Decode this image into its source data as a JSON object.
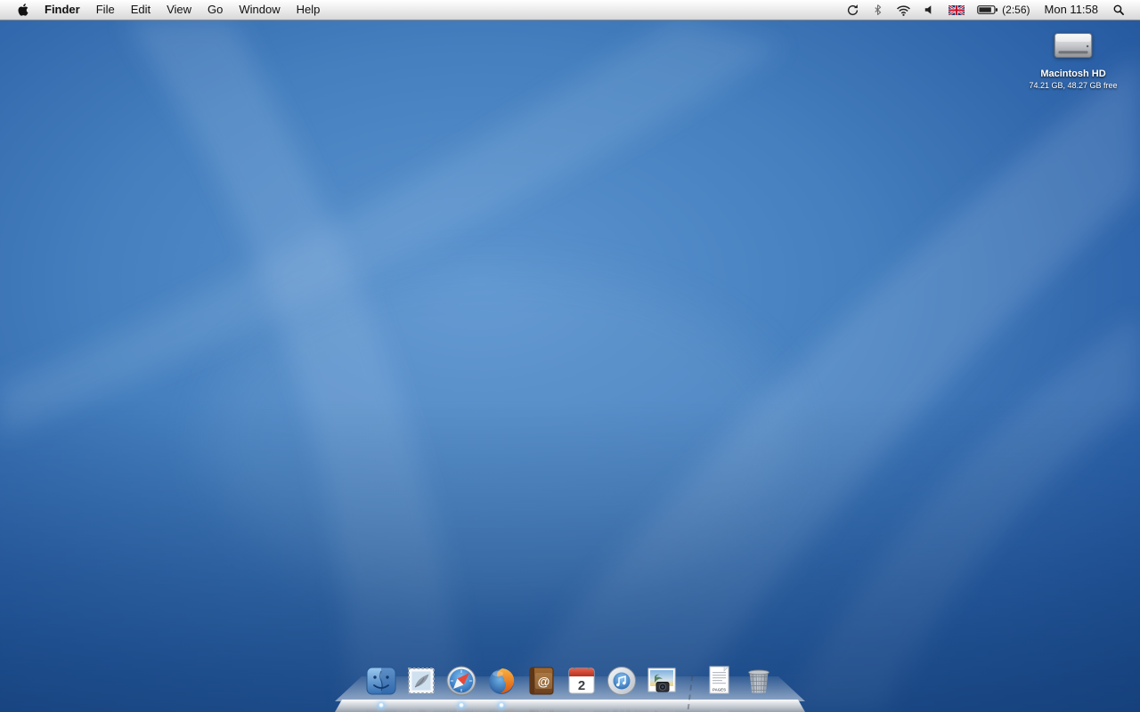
{
  "menu_bar": {
    "app_menu": "Finder",
    "menus": [
      "File",
      "Edit",
      "View",
      "Go",
      "Window",
      "Help"
    ],
    "status": {
      "battery_time": "(2:56)",
      "clock": "Mon 11:58"
    },
    "status_icons": [
      "sync",
      "bluetooth",
      "wifi",
      "volume",
      "input-flag-uk",
      "battery",
      "spotlight"
    ]
  },
  "desktop": {
    "hd_icon": {
      "label": "Macintosh HD",
      "details": "74.21 GB, 48.27 GB free"
    }
  },
  "dock": {
    "apps": [
      {
        "label": "Finder",
        "running": true
      },
      {
        "label": "Mail",
        "running": false
      },
      {
        "label": "Safari",
        "running": true
      },
      {
        "label": "Firefox",
        "running": true
      },
      {
        "label": "Address Book",
        "running": false
      },
      {
        "label": "iCal",
        "running": false
      },
      {
        "label": "iTunes",
        "running": false
      },
      {
        "label": "iPhoto",
        "running": false
      }
    ],
    "documents": [
      {
        "label": "Pages document"
      },
      {
        "label": "Trash"
      }
    ],
    "ical_day": "2",
    "pages_badge": "PAGES",
    "addressbook_glyph": "@"
  },
  "colors": {
    "menu_bar_top": "#ffffff",
    "menu_bar_bottom": "#d7d7d7",
    "desktop_light": "#5c94cf",
    "desktop_dark": "#1b4a8c",
    "running_indicator_glow": "#9fd8ff",
    "ical_header_red": "#d6402b",
    "addressbook_brown": "#8a5a2b"
  }
}
